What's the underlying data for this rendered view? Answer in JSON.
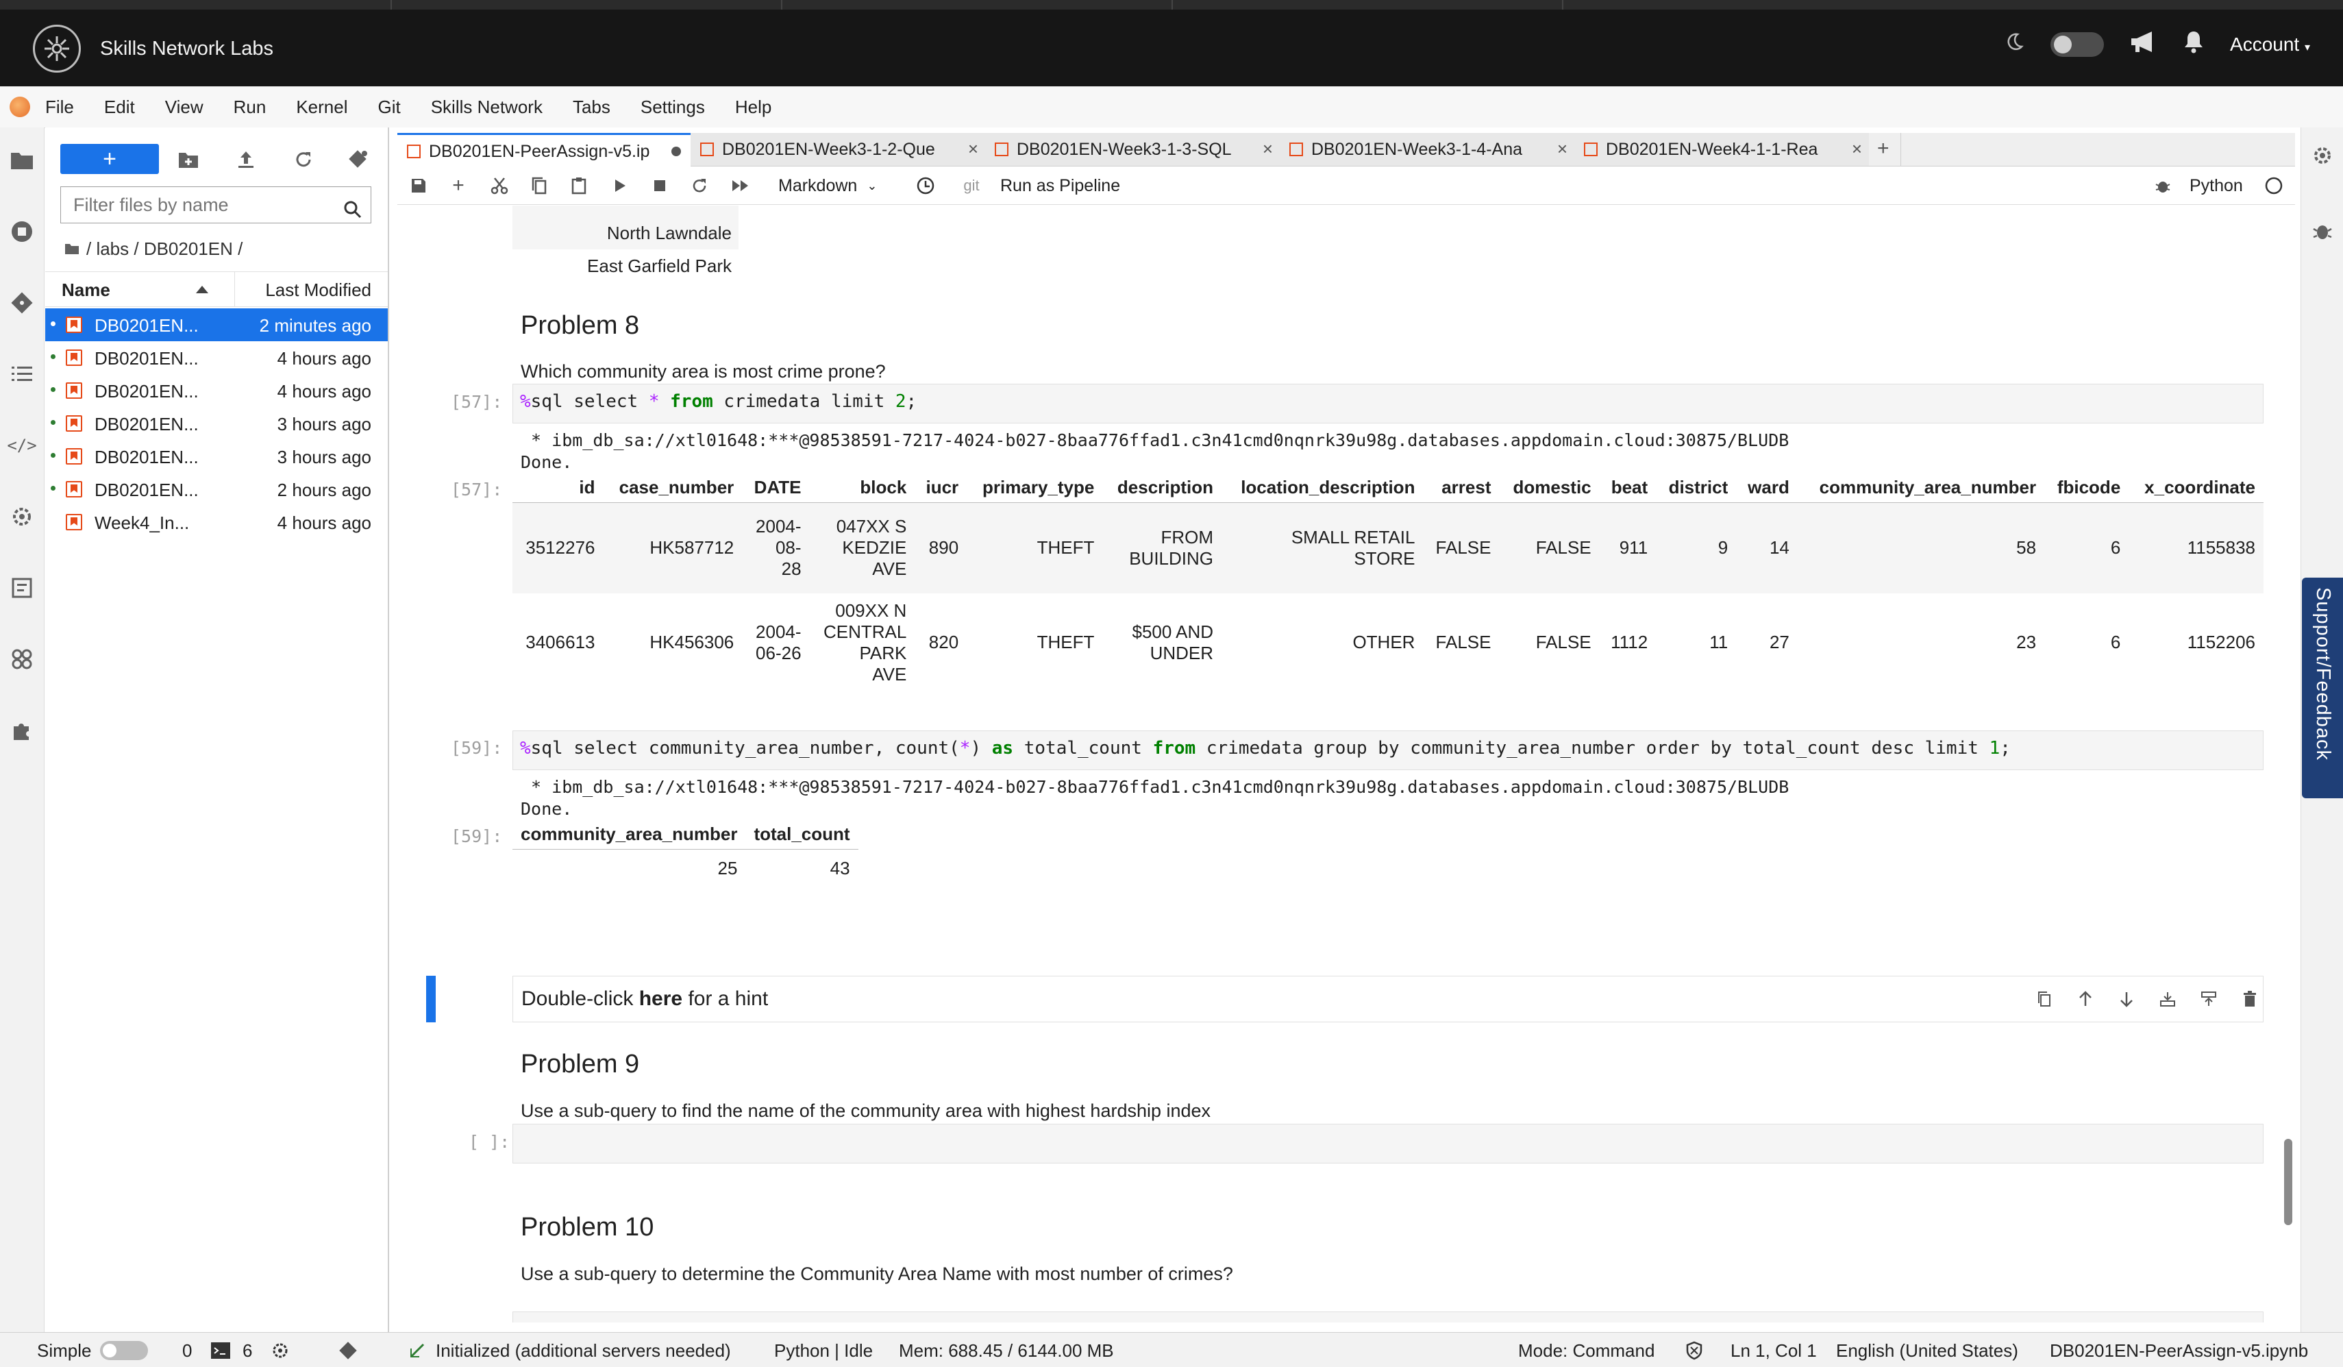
{
  "header": {
    "brand": "Skills Network Labs",
    "account": "Account"
  },
  "menubar": {
    "items": [
      "File",
      "Edit",
      "View",
      "Run",
      "Kernel",
      "Git",
      "Skills Network",
      "Tabs",
      "Settings",
      "Help"
    ]
  },
  "filebrowser": {
    "new_label": "+",
    "filter_placeholder": "Filter files by name",
    "breadcrumb": "/ labs / DB0201EN /",
    "col_name": "Name",
    "col_modified": "Last Modified",
    "files": [
      {
        "name": "DB0201EN...",
        "modified": "2 minutes ago",
        "running": true,
        "selected": true
      },
      {
        "name": "DB0201EN...",
        "modified": "4 hours ago",
        "running": true,
        "selected": false
      },
      {
        "name": "DB0201EN...",
        "modified": "4 hours ago",
        "running": true,
        "selected": false
      },
      {
        "name": "DB0201EN...",
        "modified": "3 hours ago",
        "running": true,
        "selected": false
      },
      {
        "name": "DB0201EN...",
        "modified": "3 hours ago",
        "running": true,
        "selected": false
      },
      {
        "name": "DB0201EN...",
        "modified": "2 hours ago",
        "running": true,
        "selected": false
      },
      {
        "name": "Week4_In...",
        "modified": "4 hours ago",
        "running": false,
        "selected": false
      }
    ]
  },
  "tabs": [
    {
      "label": "DB0201EN-PeerAssign-v5.ip",
      "active": true
    },
    {
      "label": "DB0201EN-Week3-1-2-Que",
      "active": false
    },
    {
      "label": "DB0201EN-Week3-1-3-SQL",
      "active": false
    },
    {
      "label": "DB0201EN-Week3-1-4-Ana",
      "active": false
    },
    {
      "label": "DB0201EN-Week4-1-1-Rea",
      "active": false
    }
  ],
  "toolbar": {
    "cell_type": "Markdown",
    "git": "git",
    "run_pipeline": "Run as Pipeline",
    "kernel": "Python"
  },
  "notebook": {
    "prev_output_rows": [
      "North Lawndale",
      "East Garfield Park"
    ],
    "problem8": {
      "title": "Problem 8",
      "question": "Which community area is most crime prone?"
    },
    "cell57": {
      "prompt_in": "[57]:",
      "prompt_out": "[57]:",
      "conn": " * ibm_db_sa://xtl01648:***@98538591-7217-4024-b027-8baa776ffad1.c3n41cmd0nqnrk39u98g.databases.appdomain.cloud:30875/BLUDB",
      "done": "Done.",
      "columns": [
        "id",
        "case_number",
        "DATE",
        "block",
        "iucr",
        "primary_type",
        "description",
        "location_description",
        "arrest",
        "domestic",
        "beat",
        "district",
        "ward",
        "community_area_number",
        "fbicode",
        "x_coordinate"
      ],
      "rows": [
        [
          "3512276",
          "HK587712",
          "2004-\n08-\n28",
          "047XX S\nKEDZIE\nAVE",
          "890",
          "THEFT",
          "FROM\nBUILDING",
          "SMALL RETAIL\nSTORE",
          "FALSE",
          "FALSE",
          "911",
          "9",
          "14",
          "58",
          "6",
          "1155838"
        ],
        [
          "3406613",
          "HK456306",
          "2004-\n06-26",
          "009XX N\nCENTRAL\nPARK\nAVE",
          "820",
          "THEFT",
          "$500 AND\nUNDER",
          "OTHER",
          "FALSE",
          "FALSE",
          "1112",
          "11",
          "27",
          "23",
          "6",
          "1152206"
        ]
      ]
    },
    "cell59": {
      "prompt_in": "[59]:",
      "prompt_out": "[59]:",
      "conn": " * ibm_db_sa://xtl01648:***@98538591-7217-4024-b027-8baa776ffad1.c3n41cmd0nqnrk39u98g.databases.appdomain.cloud:30875/BLUDB",
      "done": "Done.",
      "columns": [
        "community_area_number",
        "total_count"
      ],
      "rows": [
        [
          "25",
          "43"
        ]
      ]
    },
    "hint": {
      "pre": "Double-click ",
      "bold": "here",
      "post": " for a hint"
    },
    "problem9": {
      "title": "Problem 9",
      "question": "Use a sub-query to find the name of the community area with highest hardship index",
      "prompt": "[ ]:"
    },
    "problem10": {
      "title": "Problem 10",
      "question": "Use a sub-query to determine the Community Area Name with most number of crimes?"
    }
  },
  "sidebar_right": {
    "support": "Support/Feedback"
  },
  "statusbar": {
    "mode_label": "Simple",
    "terminals": "0",
    "kernels": "6",
    "lsp": "Initialized (additional servers needed)",
    "kernel_status": "Python | Idle",
    "memory": "Mem: 688.45 / 6144.00 MB",
    "mode": "Mode: Command",
    "cursor": "Ln 1, Col 1",
    "language": "English (United States)",
    "filename": "DB0201EN-PeerAssign-v5.ipynb"
  },
  "colors": {
    "accent": "#1a73e8",
    "header_bg": "#161616",
    "support_bg": "#1f3f77"
  }
}
